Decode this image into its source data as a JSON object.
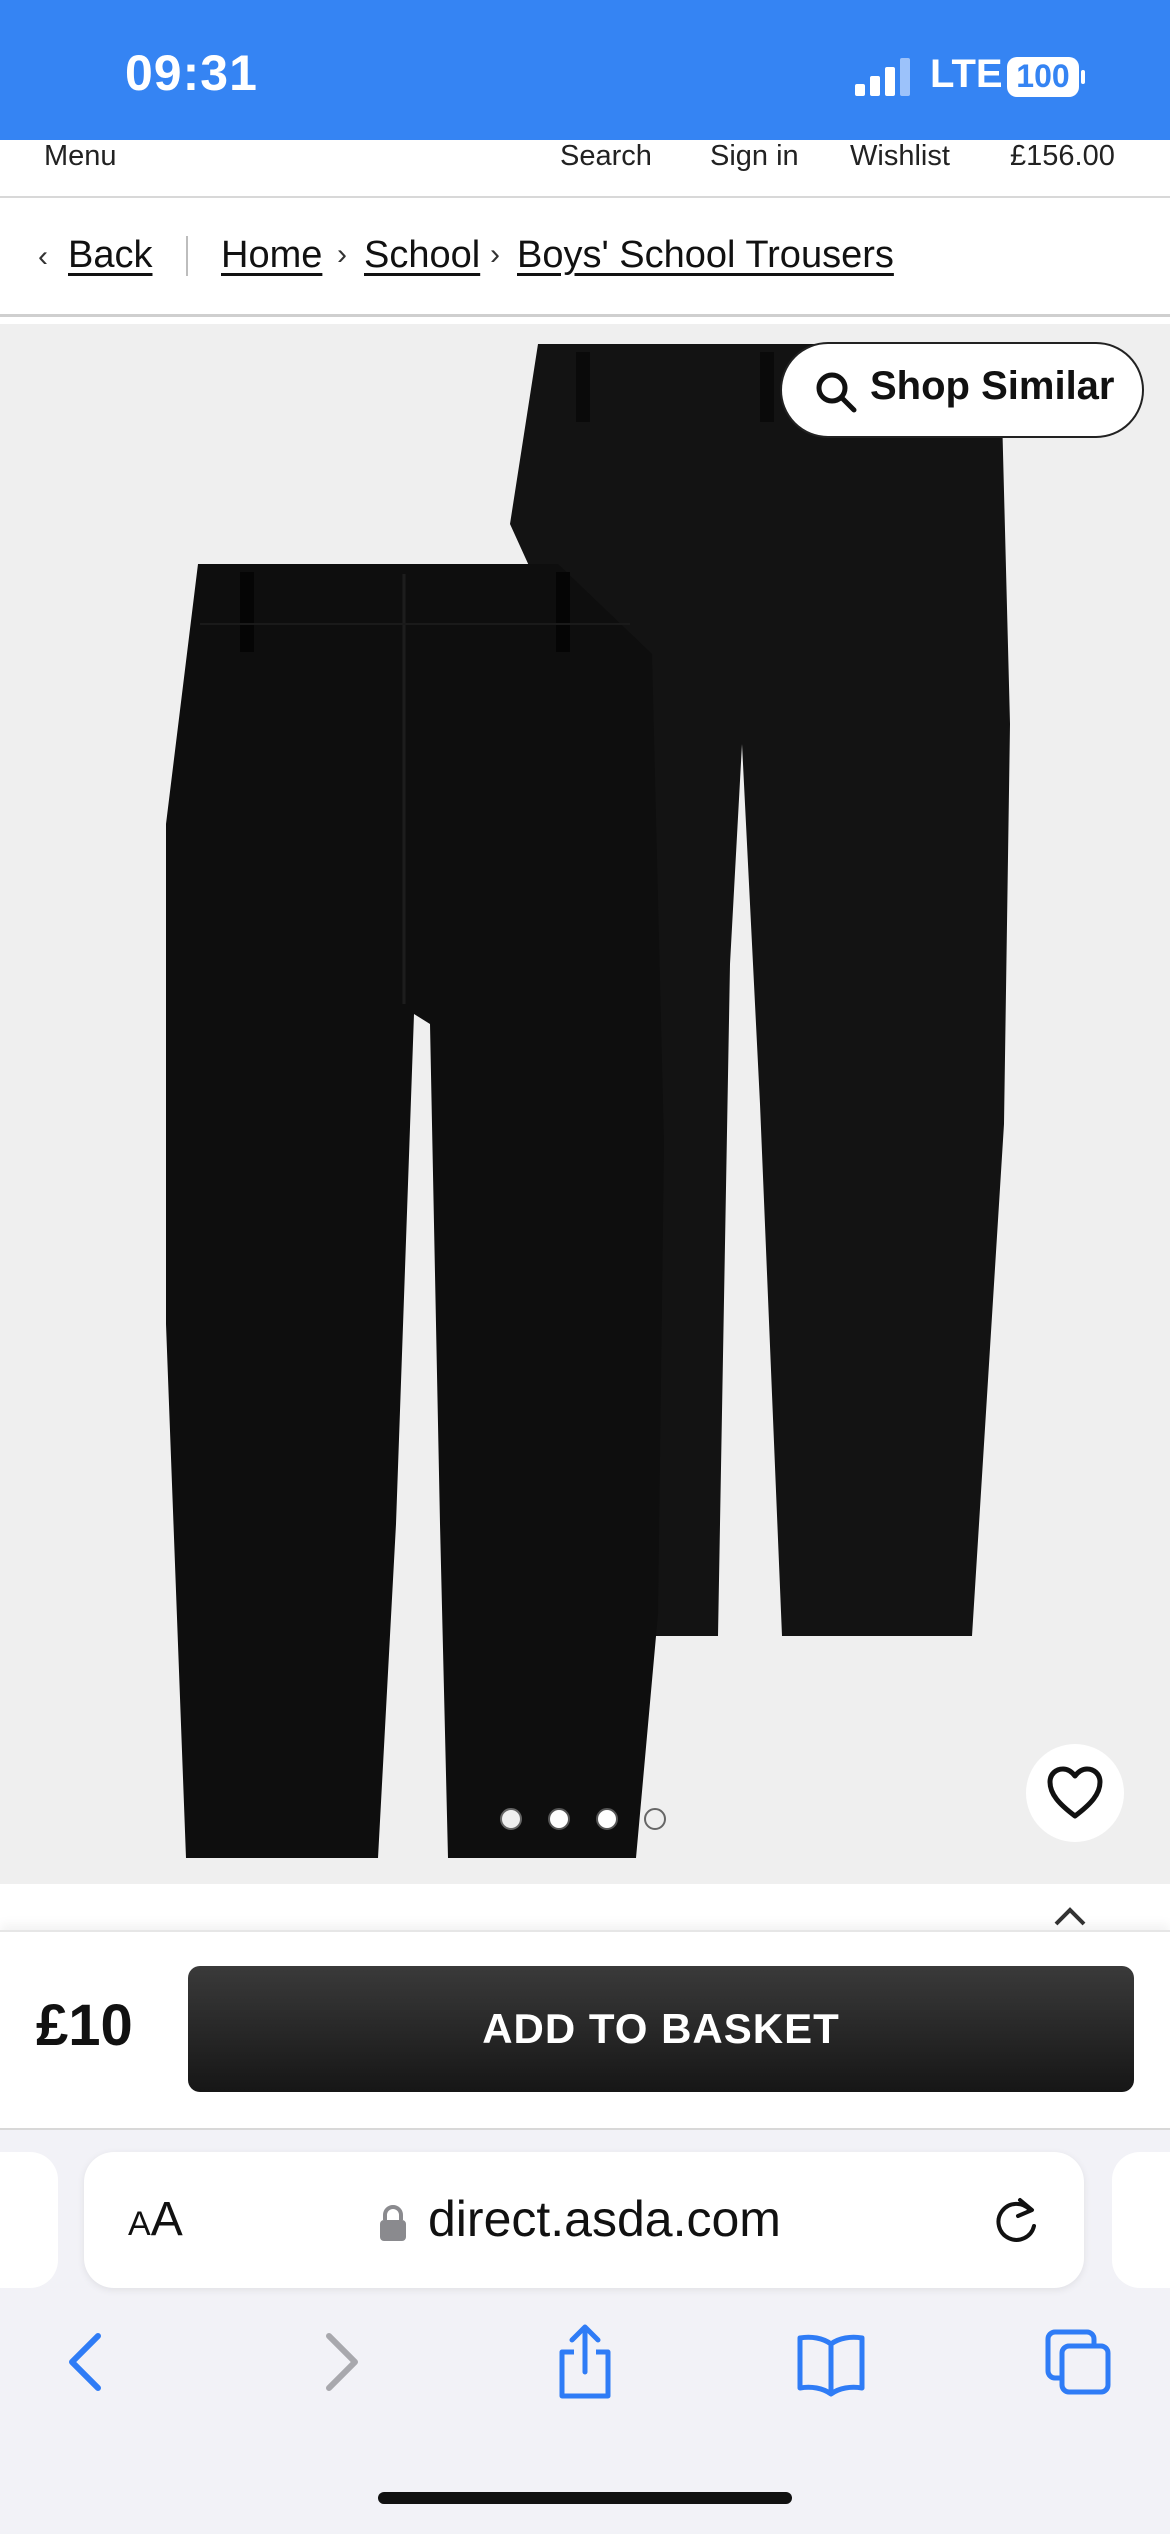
{
  "status_bar": {
    "time": "09:31",
    "network": "LTE",
    "battery": "100"
  },
  "site_nav": {
    "menu_label": "Menu",
    "search_label": "Search",
    "signin_label": "Sign in",
    "wishlist_label": "Wishlist",
    "basket_total": "£156.00"
  },
  "breadcrumb": {
    "back_label": "Back",
    "items": [
      "Home",
      "School",
      "Boys' School Trousers"
    ]
  },
  "product": {
    "shop_similar_label": "Shop Similar",
    "image_count": 4,
    "active_image_index": 1
  },
  "buy_bar": {
    "price": "£10",
    "add_to_basket_label": "ADD TO BASKET"
  },
  "browser": {
    "url": "direct.asda.com",
    "text_size_small": "A",
    "text_size_large": "A"
  },
  "colors": {
    "status_bar": "#3584f3",
    "safari_blue": "#2f7cf6",
    "button_dark": "#1f1f1f"
  },
  "icons": [
    "signal-icon",
    "battery-icon",
    "chevron-left-icon",
    "chevron-right-icon",
    "search-icon",
    "heart-icon",
    "lock-icon",
    "reload-icon",
    "back-icon",
    "forward-icon",
    "share-icon",
    "bookmarks-icon",
    "tabs-icon"
  ]
}
